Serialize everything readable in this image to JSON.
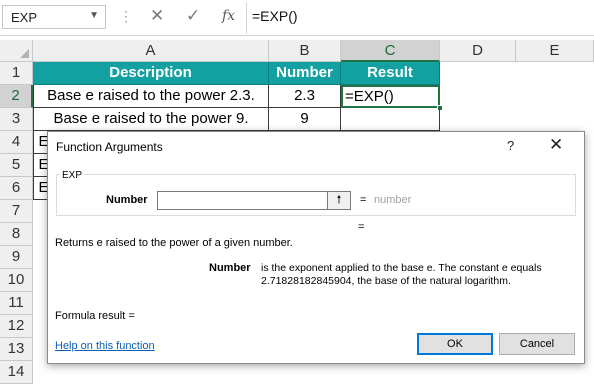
{
  "formula_bar": {
    "name_box": "EXP",
    "name_box_caret": "▼",
    "separator": "⋮",
    "cancel_icon": "✕",
    "enter_icon": "✓",
    "fx_icon": "fx",
    "formula": "=EXP()"
  },
  "grid": {
    "columns": [
      "A",
      "B",
      "C",
      "D",
      "E"
    ],
    "active_column": "C",
    "rows": [
      "1",
      "2",
      "3",
      "4",
      "5",
      "6",
      "7",
      "8",
      "9",
      "10",
      "11",
      "12",
      "13",
      "14"
    ],
    "active_row": "2",
    "header": {
      "description": "Description",
      "number": "Number",
      "result": "Result"
    },
    "data_rows": [
      {
        "description": "Base e raised to the power 2.3.",
        "number": "2.3",
        "result": "=EXP()"
      },
      {
        "description": "Base e raised to the power 9.",
        "number": "9",
        "result": ""
      }
    ],
    "partial_a_cells": [
      "E",
      "E",
      "E"
    ],
    "header_color": "#13a0a0",
    "selection_color": "#217346"
  },
  "dialog": {
    "title": "Function Arguments",
    "help_icon": "?",
    "close_icon": "✕",
    "function_name": "EXP",
    "arg_label": "Number",
    "arg_value": "",
    "collapse_icon": "🠕",
    "arg_equals": "=",
    "arg_hint": "number",
    "result_equals": "=",
    "function_description": "Returns e raised to the power of a given number.",
    "arg_desc_name": "Number",
    "arg_description": "is the exponent applied to the base e. The constant e equals 2.71828182845904, the base of the natural logarithm.",
    "formula_result": "Formula result =",
    "help_link": "Help on this function",
    "ok_label": "OK",
    "cancel_label": "Cancel"
  }
}
